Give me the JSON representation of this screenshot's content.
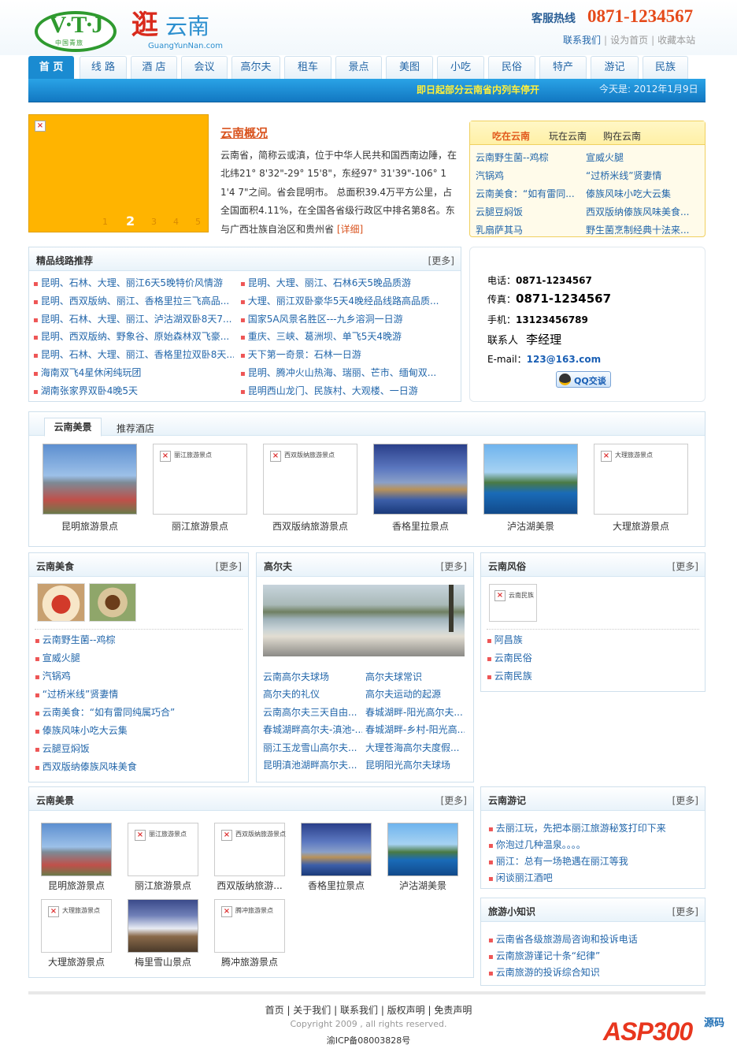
{
  "header": {
    "logo_mark": "V·T·J",
    "logo_sub": "中国青旅",
    "brand_big": "逛",
    "brand_yn": "云南",
    "brand_url": "GuangYunNan.com",
    "hotline_label": "客服热线",
    "hotline_number": "0871-1234567",
    "links": [
      "联系我们",
      "设为首页",
      "收藏本站"
    ]
  },
  "nav": {
    "tabs": [
      "首 页",
      "线 路",
      "酒 店",
      "会议",
      "高尔夫",
      "租车",
      "景点",
      "美图",
      "小吃",
      "民俗",
      "特产",
      "游记",
      "民族"
    ],
    "active_index": 0,
    "notice": "即日起部分云南省内列车停开",
    "today": "今天是: 2012年1月9日"
  },
  "colors": {
    "accent": "#1a8bd1",
    "brand_red": "#d92a1c",
    "hotline": "#e54a1a",
    "notice": "#ffef3a",
    "slide_bg": "#ffb400"
  },
  "slider": {
    "pages": [
      "1",
      "2",
      "3",
      "4",
      "5"
    ],
    "current": "2"
  },
  "intro": {
    "title": "云南概况",
    "text": "云南省，简称云或滇，位于中华人民共和国西南边陲，在北纬21° 8'32\"-29° 15'8\"，东经97° 31'39\"-106° 11'4 7\"之间。省会昆明市。 总面积39.4万平方公里，占全国面积4.11%，在全国各省级行政区中排名第8名。东与广西壮族自治区和贵州省",
    "more_label": "[详细]"
  },
  "food_tabs": {
    "tabs": [
      "吃在云南",
      "玩在云南",
      "购在云南"
    ],
    "items": [
      "云南野生菌--鸡棕",
      "宣威火腿",
      "汽锅鸡",
      "“过桥米线”贤妻情",
      "云南美食：“如有雷同...",
      "傣族风味小吃大云集",
      "云腿豆焖饭",
      "西双版纳傣族风味美食...",
      "乳扇萨其马",
      "野生菌烹制经典十法来..."
    ]
  },
  "routes": {
    "title": "精品线路推荐",
    "more": "[更多]",
    "left": [
      "昆明、石林、大理、丽江6天5晚特价风情游",
      "昆明、西双版纳、丽江、香格里拉三飞高品...",
      "昆明、石林、大理、丽江、泸沽湖双卧8天7...",
      "昆明、西双版纳、野象谷、原始森林双飞豪...",
      "昆明、石林、大理、丽江、香格里拉双卧8天...",
      "海南双飞4星休闲纯玩团",
      "湖南张家界双卧4晚5天"
    ],
    "right": [
      "昆明、大理、丽江、石林6天5晚品质游",
      "大理、丽江双卧豪华5天4晚经品线路高品质...",
      "国家5A风景名胜区---九乡溶洞一日游",
      "重庆、三峡、葛洲坝、单飞5天4晚游",
      "天下第一奇景：石林一日游",
      "昆明、腾冲火山热海、瑞丽、芒市、缅甸双...",
      "昆明西山龙门、民族村、大观楼、一日游"
    ]
  },
  "contact": {
    "phone_label": "电话：",
    "phone": "0871-1234567",
    "fax_label": "传真：",
    "fax": "0871-1234567",
    "mobile_label": "手机：",
    "mobile": "13123456789",
    "person_label": "联系人",
    "person": "李经理",
    "email_label": "E-mail：",
    "email": "123@163.com",
    "qq_label": "QQ交谈"
  },
  "showcase": {
    "tabs": [
      "云南美景",
      "推荐酒店"
    ],
    "items": [
      {
        "caption": "昆明旅游景点",
        "alt": ""
      },
      {
        "caption": "丽江旅游景点",
        "alt": "丽江旅游景点"
      },
      {
        "caption": "西双版纳旅游景点",
        "alt": "西双版纳旅游景点"
      },
      {
        "caption": "香格里拉景点",
        "alt": ""
      },
      {
        "caption": "泸沽湖美景",
        "alt": ""
      },
      {
        "caption": "大理旅游景点",
        "alt": "大理旅游景点"
      }
    ]
  },
  "food": {
    "title": "云南美食",
    "more": "[更多]",
    "items": [
      "云南野生菌--鸡棕",
      "宣威火腿",
      "汽锅鸡",
      "“过桥米线”贤妻情",
      "云南美食：“如有雷同纯属巧合”",
      "傣族风味小吃大云集",
      "云腿豆焖饭",
      "西双版纳傣族风味美食"
    ]
  },
  "golf": {
    "title": "高尔夫",
    "more": "[更多]",
    "left": [
      "云南高尔夫球场",
      "高尔夫的礼仪",
      "云南高尔夫三天自由...",
      "春城湖畔高尔夫-滇池-...",
      "丽江玉龙雪山高尔夫...",
      "昆明滇池湖畔高尔夫..."
    ],
    "right": [
      "高尔夫球常识",
      "高尔夫运动的起源",
      "春城湖畔-阳光高尔夫...",
      "春城湖畔-乡村-阳光高...",
      "大理苍海高尔夫度假...",
      "昆明阳光高尔夫球场"
    ]
  },
  "custom": {
    "title": "云南风俗",
    "more": "[更多]",
    "img_alt": "云南民族",
    "items": [
      "阿昌族",
      "云南民俗",
      "云南民族"
    ]
  },
  "scenery": {
    "title": "云南美景",
    "more": "[更多]",
    "items": [
      {
        "caption": "昆明旅游景点",
        "alt": ""
      },
      {
        "caption": "丽江旅游景点",
        "alt": "丽江旅游景点"
      },
      {
        "caption": "西双版纳旅游...",
        "alt": "西双版纳旅游景点"
      },
      {
        "caption": "香格里拉景点",
        "alt": ""
      },
      {
        "caption": "泸沽湖美景",
        "alt": ""
      },
      {
        "caption": "大理旅游景点",
        "alt": "大理旅游景点"
      },
      {
        "caption": "梅里雪山景点",
        "alt": ""
      },
      {
        "caption": "腾冲旅游景点",
        "alt": "腾冲旅游景点"
      }
    ]
  },
  "travelogue": {
    "title": "云南游记",
    "more": "[更多]",
    "items": [
      "去丽江玩，先把本丽江旅游秘笈打印下来",
      "你泡过几种温泉。。。。",
      "丽江：总有一场艳遇在丽江等我",
      "闲谈丽江酒吧"
    ]
  },
  "tips": {
    "title": "旅游小知识",
    "more": "[更多]",
    "items": [
      "云南省各级旅游局咨询和投诉电话",
      "云南旅游谨记十条“纪律”",
      "云南旅游的投诉综合知识"
    ]
  },
  "footer": {
    "links": [
      "首页",
      "关于我们",
      "联系我们",
      "版权声明",
      "免责声明"
    ],
    "copyright": "Copyright 2009 , all rights reserved.",
    "icp": "渝ICP备08003828号",
    "watermark": "ASP300",
    "watermark_sub": "源码"
  }
}
